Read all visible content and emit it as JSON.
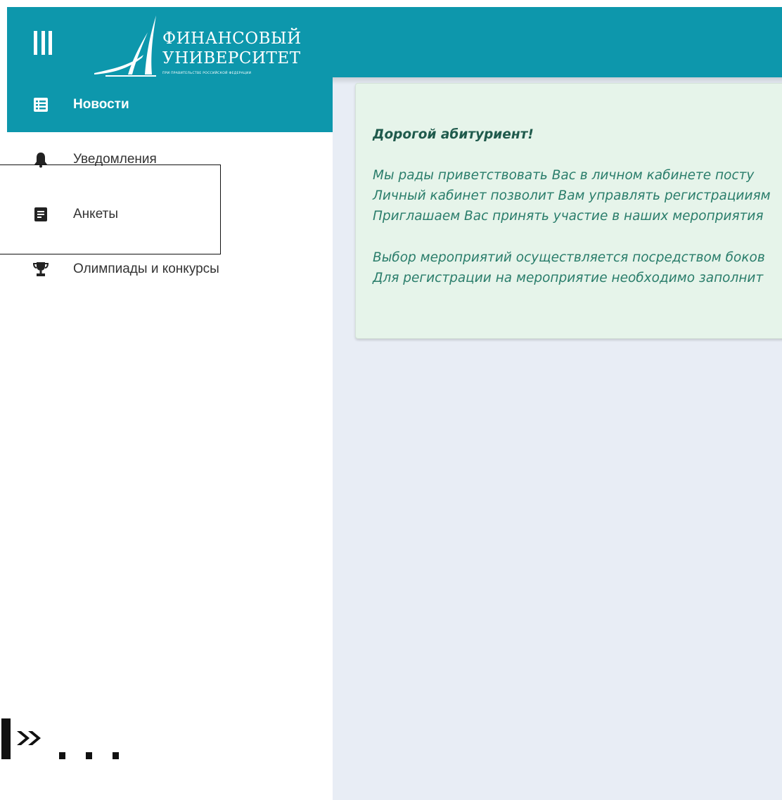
{
  "header": {
    "logo_line1": "ФИНАНСОВЫЙ",
    "logo_line2": "УНИВЕРСИТЕТ",
    "logo_subline": "ПРИ ПРАВИТЕЛЬСТВЕ РОССИЙСКОЙ ФЕДЕРАЦИИ",
    "menu_icon": "hamburger-icon",
    "brand_color": "#0d97ac"
  },
  "sidebar": {
    "items": [
      {
        "label": "Новости",
        "icon": "news-list-icon",
        "active": true
      },
      {
        "label": "Уведомления",
        "icon": "bell-icon",
        "active": false
      },
      {
        "label": "Анкеты",
        "icon": "form-icon",
        "active": false
      },
      {
        "label": "Олимпиады и конкурсы",
        "icon": "trophy-icon",
        "active": false
      }
    ]
  },
  "news_card": {
    "heading": "Дорогой абитуриент!",
    "lines": [
      "Мы рады приветствовать Вас в личном кабинете посту",
      "Личный кабинет позволит Вам управлять регистрацииям",
      "Приглашаем Вас принять участие в наших мероприятия",
      "Выбор мероприятий осуществляется посредством боков",
      "Для регистрации на мероприятие необходимо заполнит"
    ],
    "background": "#e6f4ea",
    "text_color": "#2a7d6b"
  },
  "footer_mark": {
    "icon": "expand-arrows-icon",
    "ellipsis": ". . ."
  }
}
